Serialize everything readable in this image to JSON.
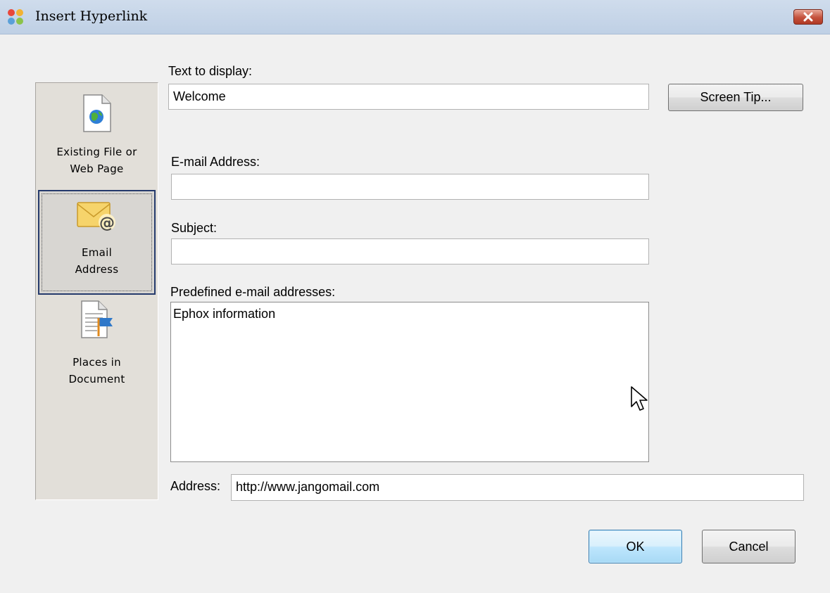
{
  "window": {
    "title": "Insert Hyperlink",
    "close_icon": "close-icon"
  },
  "nav": {
    "items": [
      {
        "label": "Existing File or\nWeb Page",
        "icon": "globe-document-icon",
        "selected": false
      },
      {
        "label": "Email\nAddress",
        "icon": "email-envelope-icon",
        "selected": true
      },
      {
        "label": "Places in\nDocument",
        "icon": "document-bookmark-icon",
        "selected": false
      }
    ]
  },
  "form": {
    "text_to_display_label": "Text to display:",
    "text_to_display_value": "Welcome",
    "screen_tip_label": "Screen Tip...",
    "email_address_label": "E-mail Address:",
    "email_address_value": "",
    "subject_label": "Subject:",
    "subject_value": "",
    "predefined_label": "Predefined e-mail addresses:",
    "predefined_items": [
      "Ephox information"
    ],
    "address_label": "Address:",
    "address_value": "http://www.jangomail.com"
  },
  "buttons": {
    "ok_label": "OK",
    "cancel_label": "Cancel"
  }
}
